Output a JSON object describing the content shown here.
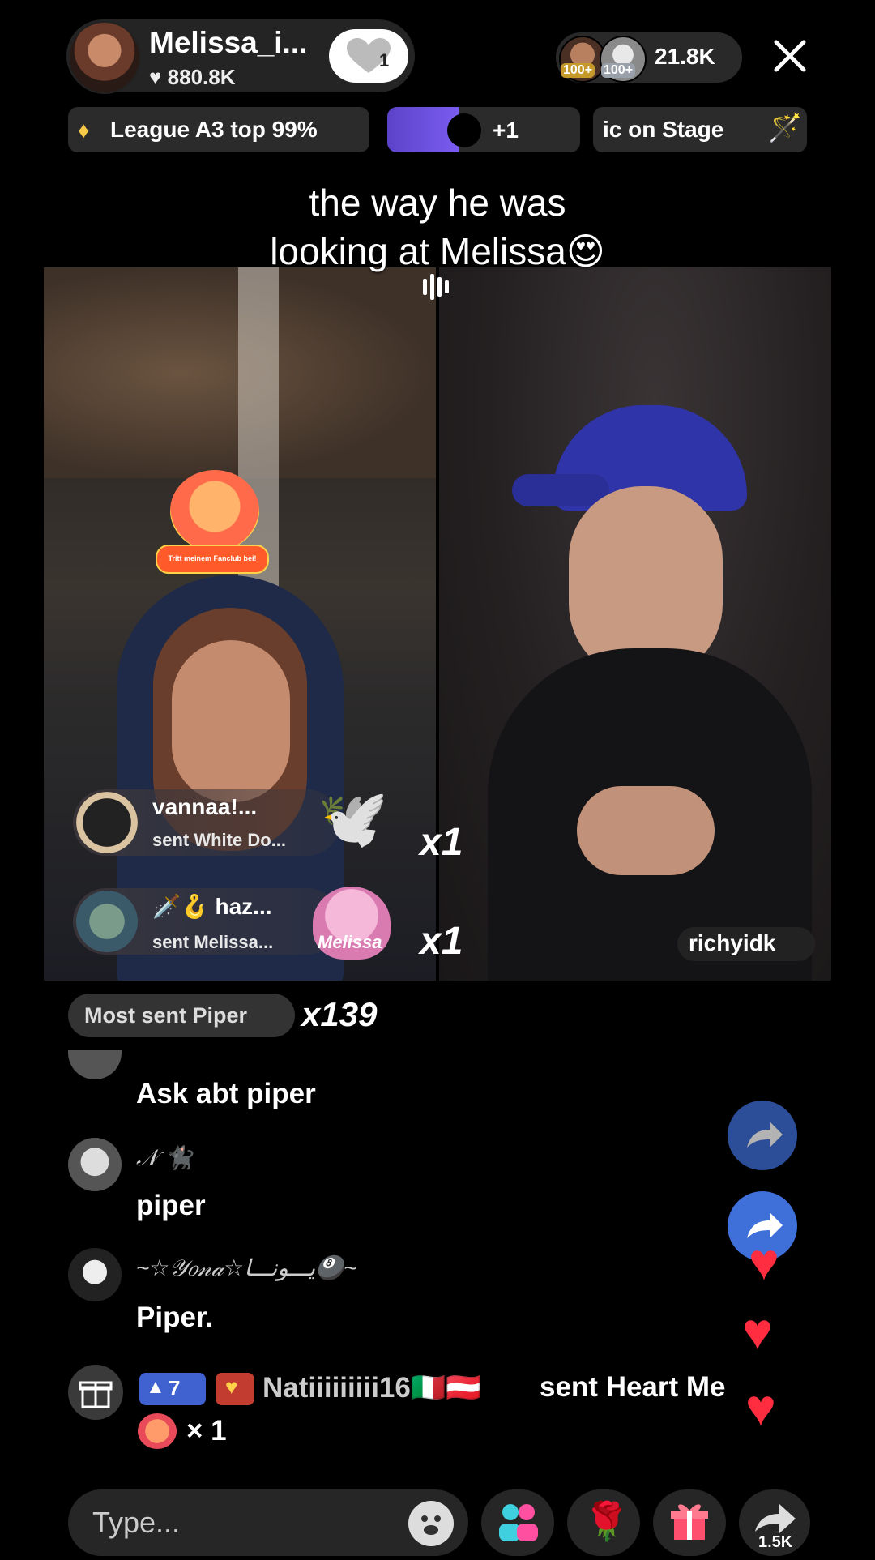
{
  "host": {
    "name": "Melissa_i...",
    "likes": "880.8K",
    "follow_count": "1"
  },
  "viewers": {
    "count": "21.8K",
    "badges": [
      "100+",
      "100+"
    ]
  },
  "close_label": "✕",
  "league": {
    "text": "League A3 top 99%"
  },
  "progress": {
    "plus": "+1",
    "fill_fraction": 0.37
  },
  "stage": {
    "text": "ic on Stage"
  },
  "caption": {
    "line1": "the way he was",
    "line2": "looking at Melissa😍"
  },
  "fanclub_sticker": "Tritt meinem Fanclub bei!",
  "gifts": [
    {
      "name": "vannaa!...",
      "sub": "sent White Do...",
      "count": "x1",
      "icon": "🕊️"
    },
    {
      "name": "🗡️🪝 haz...",
      "sub": "sent Melissa...",
      "count": "x1",
      "icon": "Melissa"
    }
  ],
  "right_guest": {
    "name": "richyidk"
  },
  "most_sent": {
    "label": "Most sent Piper",
    "count": "x139"
  },
  "chat": [
    {
      "user": "",
      "message": "Ask abt piper"
    },
    {
      "user": "𝒩 🐈‍⬛",
      "message": "piper"
    },
    {
      "user": "~☆𝒴𝑜𝓃𝒶☆يـــونـــا🎱~",
      "message": "Piper."
    }
  ],
  "gift_line": {
    "level": "7",
    "name": "Natiiiiiiiii16🇮🇹🇦🇹",
    "sent": "sent Heart Me",
    "count": "× 1"
  },
  "input": {
    "placeholder": "Type..."
  },
  "share_count": "1.5K",
  "colors": {
    "accent": "#3f6fd9",
    "heart": "#ff2d3f",
    "progress": "#6a4fe0"
  }
}
